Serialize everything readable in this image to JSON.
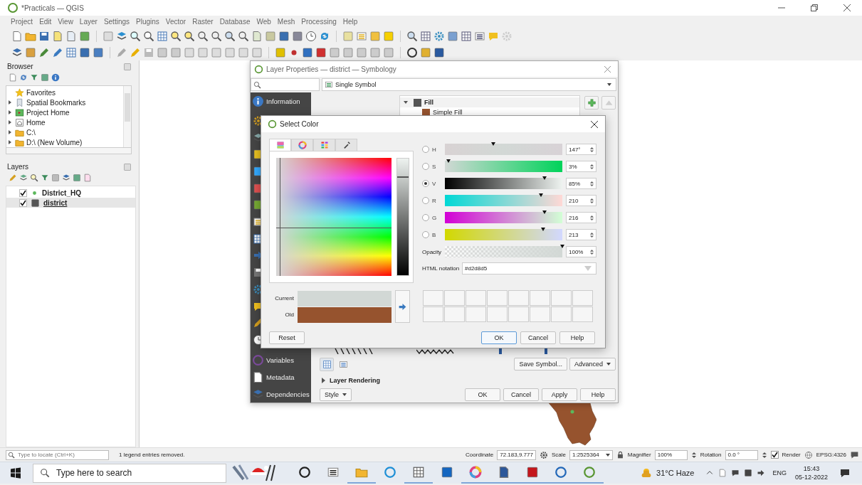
{
  "window": {
    "title": "*Practicals — QGIS"
  },
  "menu": [
    "Project",
    "Edit",
    "View",
    "Layer",
    "Settings",
    "Plugins",
    "Vector",
    "Raster",
    "Database",
    "Web",
    "Mesh",
    "Processing",
    "Help"
  ],
  "browser": {
    "title": "Browser",
    "items": [
      {
        "label": "Favorites",
        "kind": "favorites",
        "expandable": false
      },
      {
        "label": "Spatial Bookmarks",
        "kind": "bookmarks",
        "expandable": true
      },
      {
        "label": "Project Home",
        "kind": "project",
        "expandable": true
      },
      {
        "label": "Home",
        "kind": "home",
        "expandable": true
      },
      {
        "label": "C:\\",
        "kind": "drive",
        "expandable": true
      },
      {
        "label": "D:\\ (New Volume)",
        "kind": "drive",
        "expandable": true
      }
    ]
  },
  "layers": {
    "title": "Layers",
    "items": [
      {
        "label": "District_HQ",
        "kind": "point",
        "checked": true,
        "selected": false
      },
      {
        "label": "district",
        "kind": "polygon",
        "checked": true,
        "selected": true
      }
    ]
  },
  "layer_properties": {
    "title": "Layer Properties — district — Symbology",
    "renderer": "Single Symbol",
    "nav": [
      {
        "label": "Information",
        "kind": "info"
      },
      {
        "label": "Variables",
        "kind": "variables"
      },
      {
        "label": "Metadata",
        "kind": "metadata"
      },
      {
        "label": "Dependencies",
        "kind": "dependencies"
      }
    ],
    "symbol_tree": [
      {
        "label": "Fill",
        "expanded": true,
        "children": [
          {
            "label": "Simple Fill"
          }
        ]
      }
    ],
    "save_symbol": "Save Symbol...",
    "advanced": "Advanced",
    "section": "Layer Rendering",
    "style": "Style",
    "buttons": [
      "OK",
      "Cancel",
      "Apply",
      "Help"
    ]
  },
  "select_color": {
    "title": "Select Color",
    "tabs": [
      {
        "kind": "ramp",
        "selected": true
      },
      {
        "kind": "wheel",
        "selected": false
      },
      {
        "kind": "swatches",
        "selected": false
      },
      {
        "kind": "picker",
        "selected": false
      }
    ],
    "channels": [
      {
        "label": "H",
        "kind": "hue",
        "selected": false,
        "level": 0.41,
        "value": "147°"
      },
      {
        "label": "S",
        "kind": "saturation",
        "selected": false,
        "level": 0.03,
        "value": "3%"
      },
      {
        "label": "V",
        "kind": "value",
        "selected": true,
        "level": 0.85,
        "value": "85%"
      },
      {
        "label": "R",
        "kind": "red",
        "selected": false,
        "level": 0.82,
        "value": "210"
      },
      {
        "label": "G",
        "kind": "green",
        "selected": false,
        "level": 0.85,
        "value": "216"
      },
      {
        "label": "B",
        "kind": "blue",
        "selected": false,
        "level": 0.835,
        "value": "213"
      }
    ],
    "opacity": {
      "label": "Opacity",
      "level": 1,
      "value": "100%"
    },
    "html": {
      "label": "HTML notation",
      "value": "#d2d8d5"
    },
    "swatches": [
      {
        "label": "Current",
        "color": "#d2d8d5"
      },
      {
        "label": "Old",
        "color": "#96532e"
      }
    ],
    "reset": "Reset",
    "buttons": [
      "OK",
      "Cancel",
      "Help"
    ]
  },
  "status_bar": {
    "locate_placeholder": "Type to locate (Ctrl+K)",
    "message": "1 legend entries removed.",
    "coordinate_label": "Coordinate",
    "coordinate": "72.183,9.777",
    "scale_label": "Scale",
    "scale": "1:2525364",
    "magnifier_label": "Magnifier",
    "magnifier": "100%",
    "rotation_label": "Rotation",
    "rotation": "0.0 °",
    "render": {
      "label": "Render",
      "checked": true
    },
    "crs": "EPSG:4326"
  },
  "taskbar": {
    "search_placeholder": "Type here to search",
    "apps": [
      {
        "kind": "cortana",
        "running": false
      },
      {
        "kind": "taskview",
        "running": false
      },
      {
        "kind": "explorer",
        "running": true
      },
      {
        "kind": "edge",
        "running": false
      },
      {
        "kind": "calculator",
        "running": true
      },
      {
        "kind": "mail",
        "running": false
      },
      {
        "kind": "chrome",
        "running": true
      },
      {
        "kind": "word",
        "running": true
      },
      {
        "kind": "acrobat",
        "running": true
      },
      {
        "kind": "r",
        "running": true
      },
      {
        "kind": "qgis",
        "running": true
      }
    ],
    "weather": "31°C Haze",
    "language": "ENG",
    "time": "15:43",
    "date": "05-12-2022"
  }
}
